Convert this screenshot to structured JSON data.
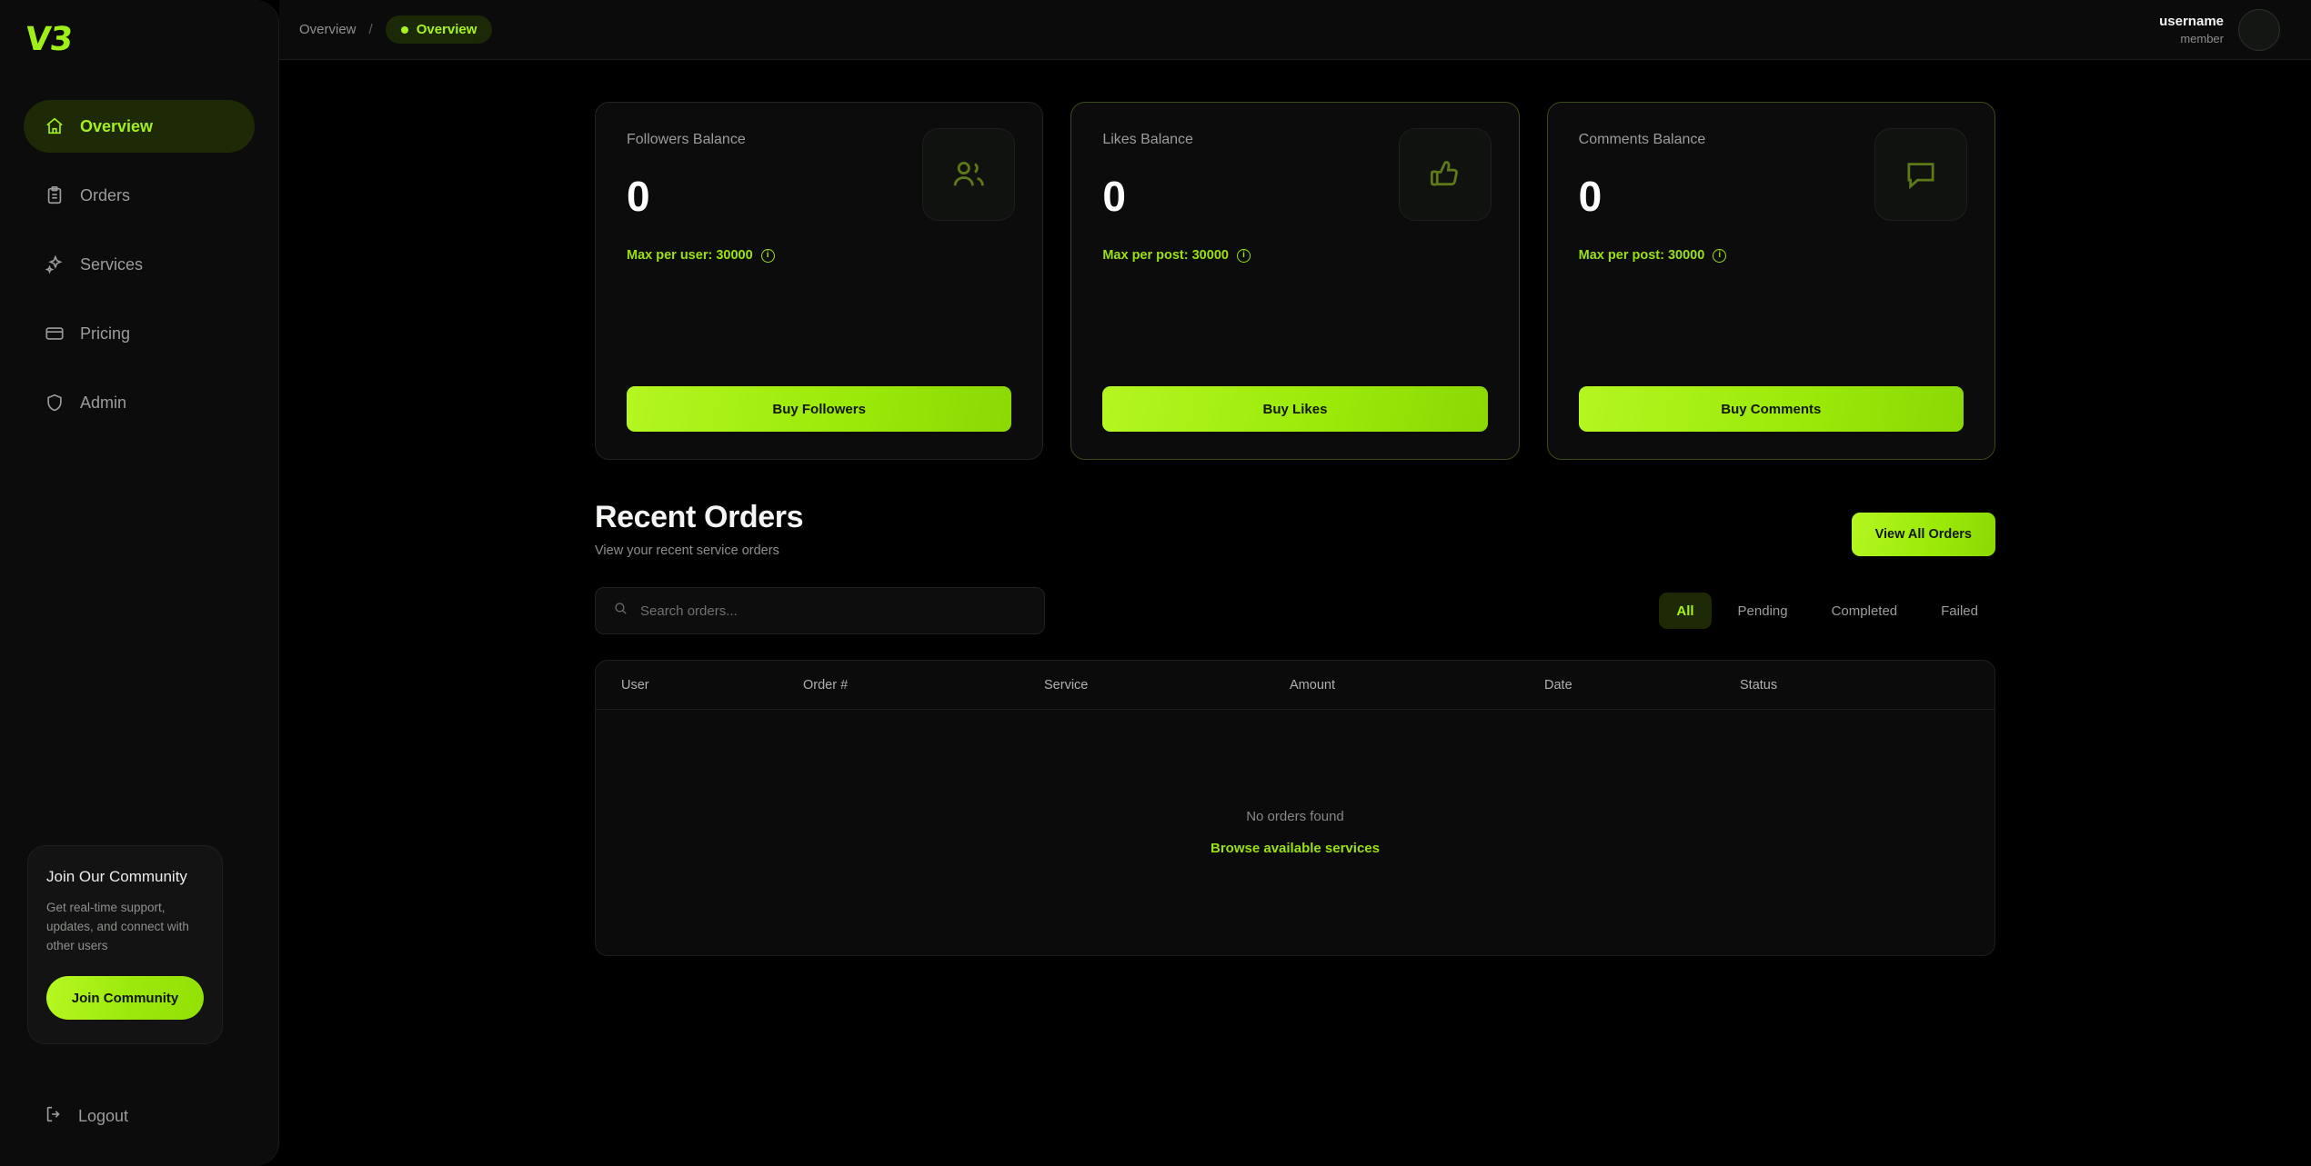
{
  "brand": {
    "logo_text": "V3"
  },
  "sidebar": {
    "items": [
      {
        "label": "Overview",
        "icon": "home-icon",
        "active": true
      },
      {
        "label": "Orders",
        "icon": "clipboard-icon",
        "active": false
      },
      {
        "label": "Services",
        "icon": "sparkles-icon",
        "active": false
      },
      {
        "label": "Pricing",
        "icon": "credit-card-icon",
        "active": false
      },
      {
        "label": "Admin",
        "icon": "shield-icon",
        "active": false
      }
    ],
    "community": {
      "title": "Join Our Community",
      "description": "Get real-time support, updates, and connect with other users",
      "button_label": "Join Community"
    },
    "logout_label": "Logout"
  },
  "topbar": {
    "breadcrumb_root": "Overview",
    "breadcrumb_separator": "/",
    "breadcrumb_current": "Overview",
    "user": {
      "name": "username",
      "role": "member"
    }
  },
  "cards": [
    {
      "title": "Followers Balance",
      "value": "0",
      "max_label": "Max per user: 30000",
      "info_glyph": "i",
      "icon": "users-icon",
      "button_label": "Buy Followers"
    },
    {
      "title": "Likes Balance",
      "value": "0",
      "max_label": "Max per post: 30000",
      "info_glyph": "i",
      "icon": "thumbs-up-icon",
      "button_label": "Buy Likes"
    },
    {
      "title": "Comments Balance",
      "value": "0",
      "max_label": "Max per post: 30000",
      "info_glyph": "i",
      "icon": "comment-icon",
      "button_label": "Buy Comments"
    }
  ],
  "recent_orders": {
    "title": "Recent Orders",
    "subtitle": "View your recent service orders",
    "view_all_label": "View All Orders",
    "search_placeholder": "Search orders...",
    "search_value": "",
    "filters": [
      {
        "label": "All",
        "active": true
      },
      {
        "label": "Pending",
        "active": false
      },
      {
        "label": "Completed",
        "active": false
      },
      {
        "label": "Failed",
        "active": false
      }
    ],
    "columns": [
      "User",
      "Order #",
      "Service",
      "Amount",
      "Date",
      "Status"
    ],
    "rows": [],
    "empty_message": "No orders found",
    "empty_link": "Browse available services"
  },
  "colors": {
    "accent": "#9be013",
    "accent_bright": "#a8f51e",
    "accent_pill_bg": "#1d2a05",
    "page_bg": "#000000",
    "panel_bg": "#0b0c0b"
  }
}
